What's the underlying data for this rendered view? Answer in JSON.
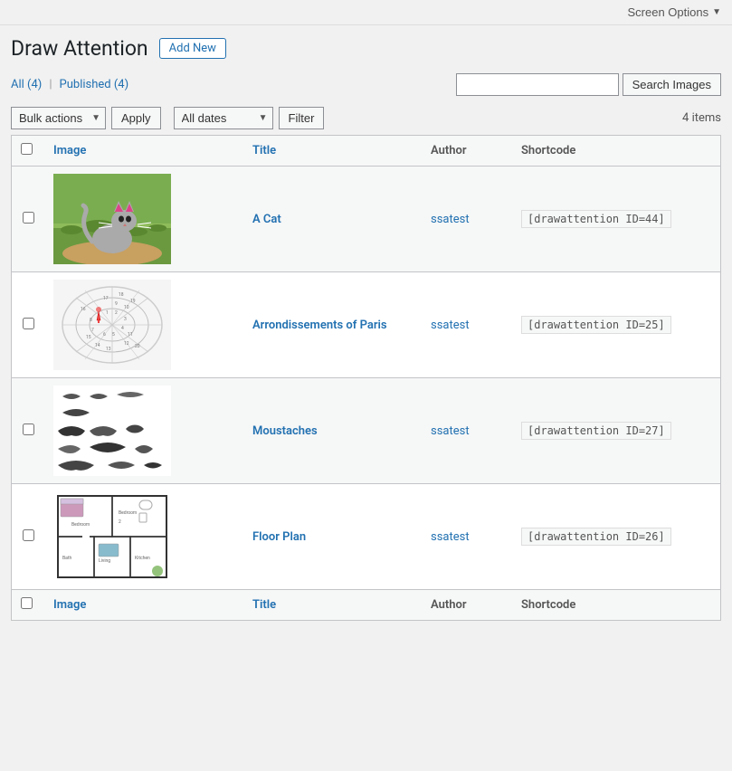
{
  "topBar": {
    "screenOptions": "Screen Options",
    "screenOptionsArrow": "▼"
  },
  "header": {
    "title": "Draw Attention",
    "addNewLabel": "Add New"
  },
  "filterLinks": {
    "all": "All",
    "allCount": "(4)",
    "published": "Published",
    "publishedCount": "(4)"
  },
  "search": {
    "placeholder": "",
    "buttonLabel": "Search Images"
  },
  "actionBar": {
    "bulkActionsLabel": "Bulk actions",
    "applyLabel": "Apply",
    "allDatesLabel": "All dates",
    "filterLabel": "Filter",
    "itemCount": "4 items"
  },
  "table": {
    "columns": {
      "image": "Image",
      "title": "Title",
      "author": "Author",
      "shortcode": "Shortcode"
    },
    "rows": [
      {
        "id": 1,
        "title": "A Cat",
        "author": "ssatest",
        "shortcode": "[drawattention ID=44]",
        "imageType": "cat"
      },
      {
        "id": 2,
        "title": "Arrondissements of Paris",
        "author": "ssatest",
        "shortcode": "[drawattention ID=25]",
        "imageType": "paris"
      },
      {
        "id": 3,
        "title": "Moustaches",
        "author": "ssatest",
        "shortcode": "[drawattention ID=27]",
        "imageType": "moustaches"
      },
      {
        "id": 4,
        "title": "Floor Plan",
        "author": "ssatest",
        "shortcode": "[drawattention ID=26]",
        "imageType": "floorplan"
      }
    ]
  }
}
